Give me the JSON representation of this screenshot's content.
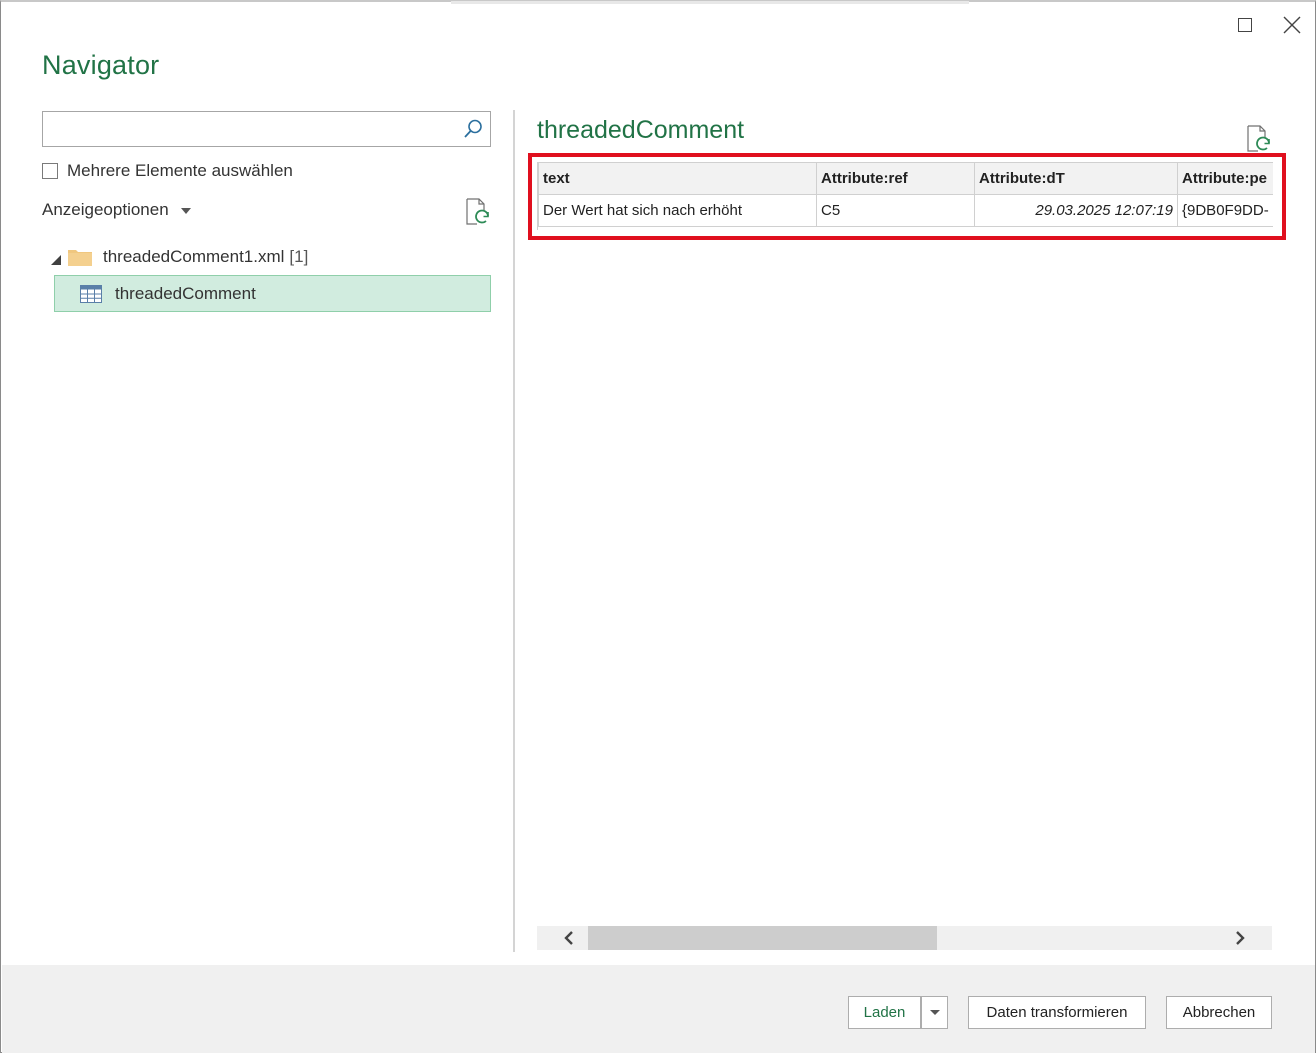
{
  "window": {
    "title": "Navigator",
    "accent_color": "#217346",
    "highlight_color": "#e00f1e"
  },
  "left_pane": {
    "search": {
      "value": "",
      "placeholder": ""
    },
    "multi_select": {
      "label": "Mehrere Elemente auswählen",
      "checked": false
    },
    "display_options_label": "Anzeigeoptionen",
    "tree": {
      "file": {
        "label": "threadedComment1.xml",
        "count": "[1]",
        "expanded": true
      },
      "tables": [
        {
          "label": "threadedComment",
          "selected": true
        }
      ]
    }
  },
  "preview": {
    "title": "threadedComment",
    "columns": [
      "text",
      "Attribute:ref",
      "Attribute:dT",
      "Attribute:pe"
    ],
    "rows": [
      [
        "Der Wert hat sich nach erhöht",
        "C5",
        "29.03.2025 12:07:19",
        "{9DB0F9DD-"
      ]
    ],
    "scroll_position": 0.07
  },
  "footer": {
    "load_label": "Laden",
    "transform_label": "Daten transformieren",
    "cancel_label": "Abbrechen"
  },
  "icons": {
    "close": "close-icon",
    "maximize": "maximize-icon",
    "search": "search-icon",
    "refresh": "refresh-icon",
    "folder": "folder-icon",
    "table": "table-icon"
  }
}
